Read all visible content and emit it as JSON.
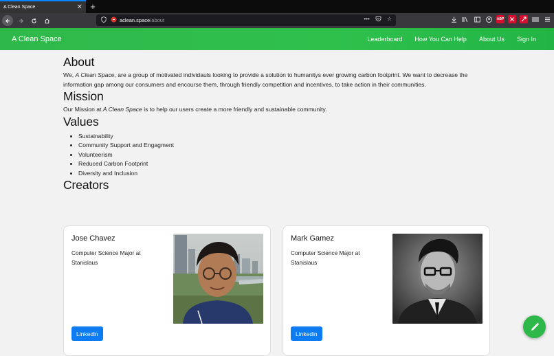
{
  "browser": {
    "tab_title": "A Clean Space",
    "tab_close": "✕",
    "new_tab": "+",
    "url_host": "aclean.space",
    "url_path": "/about",
    "icons": [
      "back-icon",
      "forward-icon",
      "reload-icon",
      "home-icon",
      "shield-icon",
      "lock-icon",
      "more-icon",
      "pocket-icon",
      "bookmark-star-icon",
      "download-icon",
      "library-icon",
      "sidebar-icon",
      "account-icon",
      "adblock-icon",
      "extension-icon",
      "extension-icon-2",
      "extension-icon-3",
      "menu-icon"
    ],
    "adblock_label": "ABP"
  },
  "header": {
    "brand": "A Clean Space",
    "nav": [
      {
        "label": "Leaderboard"
      },
      {
        "label": "How You Can Help"
      },
      {
        "label": "About Us"
      },
      {
        "label": "Sign In"
      }
    ],
    "color": "#2fb84a"
  },
  "about": {
    "title": "About",
    "text_pre": "We, ",
    "text_em": "A Clean Space",
    "text_post": ", are a group of motivated individauls looking to provide a solution to humanitys ever growing carbon footprint. We want to decrease the information gap among our consumers and encourse them, through friendly competition and incentives, to take action in their communities."
  },
  "mission": {
    "title": "Mission",
    "text_pre": "Our Mission at ",
    "text_em": "A Clean Space",
    "text_post": " is to help our users create a more friendly and sustainable community."
  },
  "values": {
    "title": "Values",
    "items": [
      "Sustainability",
      "Community Support and Engagment",
      "Volunteerism",
      "Reduced Carbon Footprint",
      "Diversity and Inclusion"
    ]
  },
  "creators": {
    "title": "Creators",
    "cards": [
      {
        "name": "Jose Chavez",
        "description": "Computer Science Major at Stanislaus",
        "button": "Linkedin"
      },
      {
        "name": "Mark Gamez",
        "description": "Computer Science Major at Stanislaus",
        "button": "Linkedin"
      }
    ]
  },
  "fab": {
    "icon": "pencil-icon",
    "color": "#2fb84a"
  }
}
